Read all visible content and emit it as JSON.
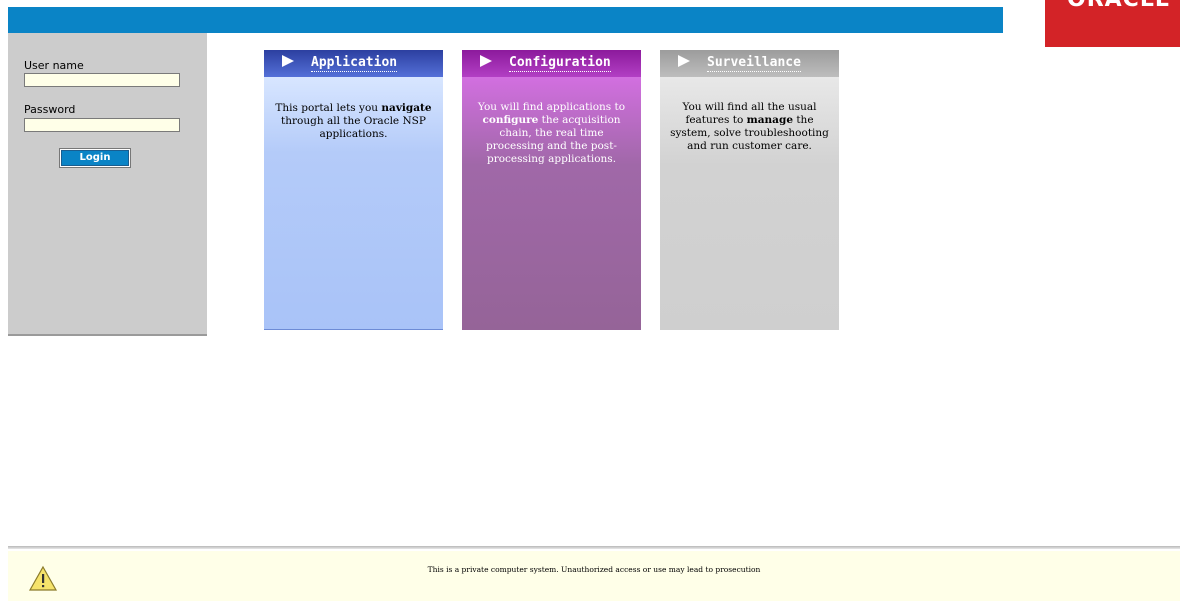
{
  "brand": {
    "logo_text": "ORACLE",
    "logo_color": "#d32327",
    "bar_color": "#0a84c6"
  },
  "login": {
    "username_label": "User name",
    "username_value": "",
    "password_label": "Password",
    "password_value": "",
    "button_label": "Login"
  },
  "cards": [
    {
      "title": "Application",
      "text_pre": "This portal lets you ",
      "text_bold": "navigate",
      "text_post": " through all the Oracle NSP applications."
    },
    {
      "title": "Configuration",
      "text_pre": "You will find applications to ",
      "text_bold": "configure",
      "text_post": " the acquisition chain, the real time processing and the post-processing applications."
    },
    {
      "title": "Surveillance",
      "text_pre": "You will find all the usual features to ",
      "text_bold": "manage",
      "text_post": " the system, solve troubleshooting and run customer care."
    }
  ],
  "footer": {
    "warning_icon": "warning-icon",
    "message": "This is a private computer system. Unauthorized access or use may lead to prosecution"
  }
}
